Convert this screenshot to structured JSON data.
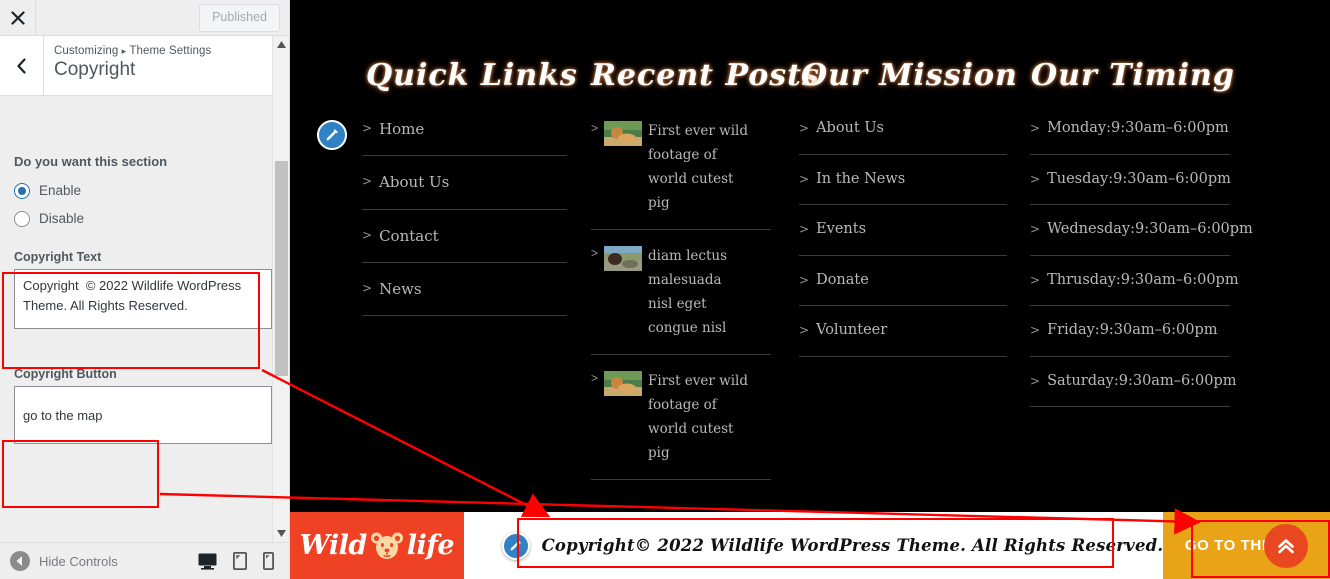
{
  "customizer": {
    "close_icon": "close-x-icon",
    "publish_button": "Published",
    "back_icon": "chevron-left-icon",
    "breadcrumb_root": "Customizing",
    "breadcrumb_caret": "▸",
    "breadcrumb_parent": "Theme Settings",
    "panel_title": "Copyright",
    "section_question": "Do you want this section",
    "radio_options": [
      {
        "label": "Enable",
        "selected": true
      },
      {
        "label": "Disable",
        "selected": false
      }
    ],
    "controls": [
      {
        "label": "Copyright Text",
        "value": "Copyright  © 2022 Wildlife WordPress Theme. All Rights Reserved.",
        "type": "textarea"
      },
      {
        "label": "Copyright Button",
        "value": "go to the map",
        "type": "text"
      }
    ],
    "footer": {
      "hide_controls": "Hide Controls",
      "devices": [
        {
          "name": "desktop-preview-icon",
          "active": true
        },
        {
          "name": "tablet-preview-icon",
          "active": false
        },
        {
          "name": "mobile-preview-icon",
          "active": false
        }
      ]
    }
  },
  "preview": {
    "columns": {
      "quick_links": {
        "heading": "Quick Links",
        "items": [
          "Home",
          "About Us",
          "Contact",
          "News"
        ]
      },
      "recent_posts": {
        "heading": "Recent Posts",
        "items": [
          {
            "title": "First ever wild footage of world cutest pig",
            "thumb": "lion-thumbnail"
          },
          {
            "title": "diam lectus malesuada nisl eget congue nisl",
            "thumb": "bear-thumbnail"
          },
          {
            "title": "First ever wild footage of world cutest pig",
            "thumb": "lion-thumbnail"
          }
        ]
      },
      "our_mission": {
        "heading": "Our Mission",
        "items": [
          "About Us",
          "In the News",
          "Events",
          "Donate",
          "Volunteer"
        ]
      },
      "our_timing": {
        "heading": "Our Timing",
        "items": [
          "Monday:9:30am–6:00pm",
          "Tuesday:9:30am–6:00pm",
          "Wednesday:9:30am–6:00pm",
          "Thrusday:9:30am–6:00pm",
          "Friday:9:30am–6:00pm",
          "Saturday:9:30am–6:00pm"
        ]
      }
    },
    "bottom_bar": {
      "logo_left": "Wild",
      "logo_right": "life",
      "logo_icon": "bear-face-icon",
      "copyright": "Copyright© 2022 Wildlife WordPress Theme. All Rights Reserved.",
      "cta_label": "GO TO THE",
      "scroll_top_icon": "double-chevron-up-icon"
    }
  },
  "colors": {
    "accent_blue": "#3082c4",
    "logo_red": "#ef4123",
    "cta_gold": "#e8a317",
    "scroll_top_red": "#e8471f",
    "annotation_red": "#ff0000",
    "footer_bg": "#000000"
  }
}
